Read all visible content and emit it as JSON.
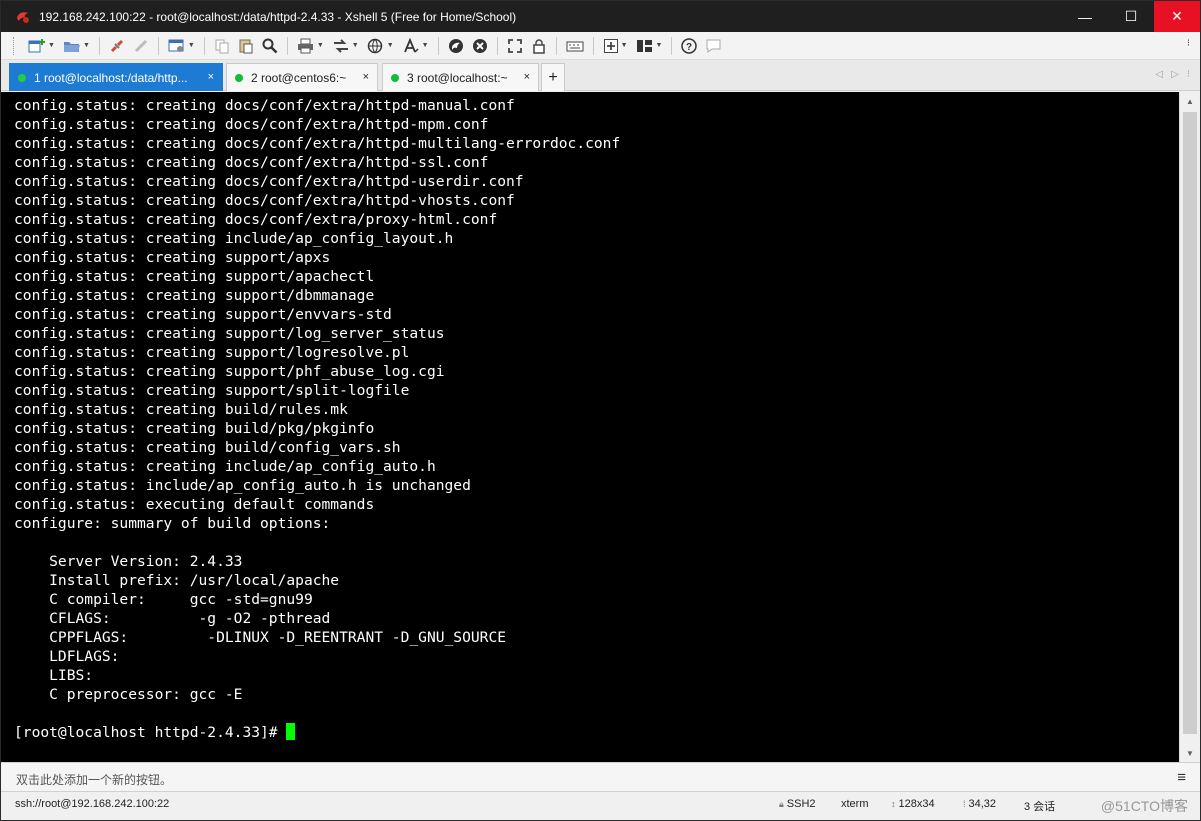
{
  "window": {
    "title": "192.168.242.100:22 - root@localhost:/data/httpd-2.4.33 - Xshell 5 (Free for Home/School)",
    "controls": {
      "minimize": "—",
      "maximize": "☐",
      "close": "✕"
    }
  },
  "tabs": [
    {
      "label": "1 root@localhost:/data/http...",
      "active": true,
      "close": "×"
    },
    {
      "label": "2 root@centos6:~",
      "active": false,
      "close": "×"
    },
    {
      "label": "3 root@localhost:~",
      "active": false,
      "close": "×"
    }
  ],
  "tab_add": "+",
  "terminal": {
    "lines": [
      "config.status: creating docs/conf/extra/httpd-manual.conf",
      "config.status: creating docs/conf/extra/httpd-mpm.conf",
      "config.status: creating docs/conf/extra/httpd-multilang-errordoc.conf",
      "config.status: creating docs/conf/extra/httpd-ssl.conf",
      "config.status: creating docs/conf/extra/httpd-userdir.conf",
      "config.status: creating docs/conf/extra/httpd-vhosts.conf",
      "config.status: creating docs/conf/extra/proxy-html.conf",
      "config.status: creating include/ap_config_layout.h",
      "config.status: creating support/apxs",
      "config.status: creating support/apachectl",
      "config.status: creating support/dbmmanage",
      "config.status: creating support/envvars-std",
      "config.status: creating support/log_server_status",
      "config.status: creating support/logresolve.pl",
      "config.status: creating support/phf_abuse_log.cgi",
      "config.status: creating support/split-logfile",
      "config.status: creating build/rules.mk",
      "config.status: creating build/pkg/pkginfo",
      "config.status: creating build/config_vars.sh",
      "config.status: creating include/ap_config_auto.h",
      "config.status: include/ap_config_auto.h is unchanged",
      "config.status: executing default commands",
      "configure: summary of build options:",
      "",
      "    Server Version: 2.4.33",
      "    Install prefix: /usr/local/apache",
      "    C compiler:     gcc -std=gnu99",
      "    CFLAGS:          -g -O2 -pthread",
      "    CPPFLAGS:         -DLINUX -D_REENTRANT -D_GNU_SOURCE",
      "    LDFLAGS:",
      "    LIBS:",
      "    C preprocessor: gcc -E",
      ""
    ],
    "prompt": "[root@localhost httpd-2.4.33]# "
  },
  "compose": {
    "placeholder": "双击此处添加一个新的按钮。",
    "menu_icon": "≡"
  },
  "status": {
    "connection": "ssh://root@192.168.242.100:22",
    "protocol": "SSH2",
    "terminal_type": "xterm",
    "size": "128x34",
    "cursor_pos": "34,32",
    "sessions": "3 会话"
  },
  "watermark": "@51CTO博客",
  "colors": {
    "tab_active": "#1e7bd4",
    "cursor": "#00ff00",
    "close_button": "#e81123",
    "status_dot": "#0fbf33"
  },
  "toolbar_icons": [
    "new-session-icon",
    "open-folder-icon",
    "disconnect-icon",
    "reconnect-icon",
    "properties-icon",
    "copy-icon",
    "paste-icon",
    "find-icon",
    "print-icon",
    "transfer-icon",
    "globe-icon",
    "font-icon",
    "xftp-icon",
    "xmanager-icon",
    "fullscreen-icon",
    "lock-icon",
    "keyboard-icon",
    "add-icon",
    "layout-icon",
    "help-icon",
    "chat-icon"
  ]
}
